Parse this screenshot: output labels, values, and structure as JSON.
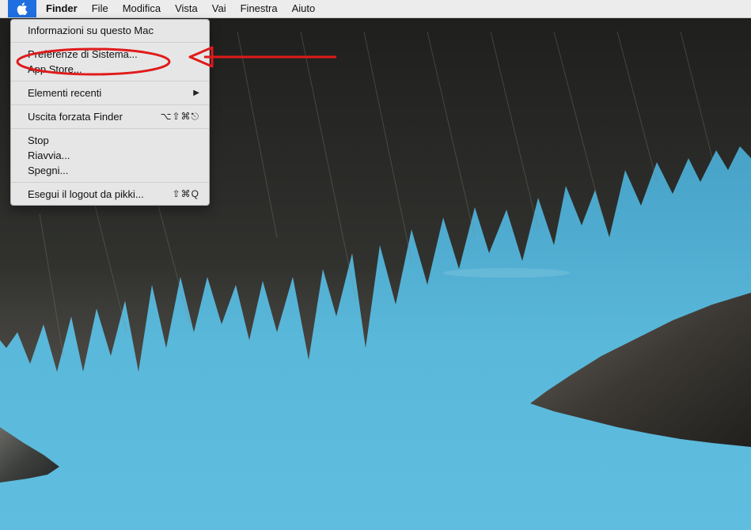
{
  "menubar": {
    "app_name": "Finder",
    "items": [
      "File",
      "Modifica",
      "Vista",
      "Vai",
      "Finestra",
      "Aiuto"
    ]
  },
  "apple_menu": {
    "items": [
      {
        "label": "Informazioni su questo Mac"
      },
      {
        "label": "Preferenze di Sistema..."
      },
      {
        "label": "App Store..."
      },
      {
        "label": "Elementi recenti",
        "submenu": "▶"
      },
      {
        "label": "Uscita forzata Finder",
        "shortcut": "⌥⇧⌘⎋"
      },
      {
        "label": "Stop"
      },
      {
        "label": "Riavvia..."
      },
      {
        "label": "Spegni..."
      },
      {
        "label": "Esegui il logout da pikki...",
        "shortcut": "⇧⌘Q"
      }
    ]
  },
  "colors": {
    "annotation": "#e01a1a",
    "apple_highlight": "#1f6fe0",
    "sky": "#4aa6cb"
  },
  "icons": {
    "apple": "apple-logo-icon",
    "submenu": "chevron-right-icon",
    "arrow": "arrow-left-icon"
  }
}
